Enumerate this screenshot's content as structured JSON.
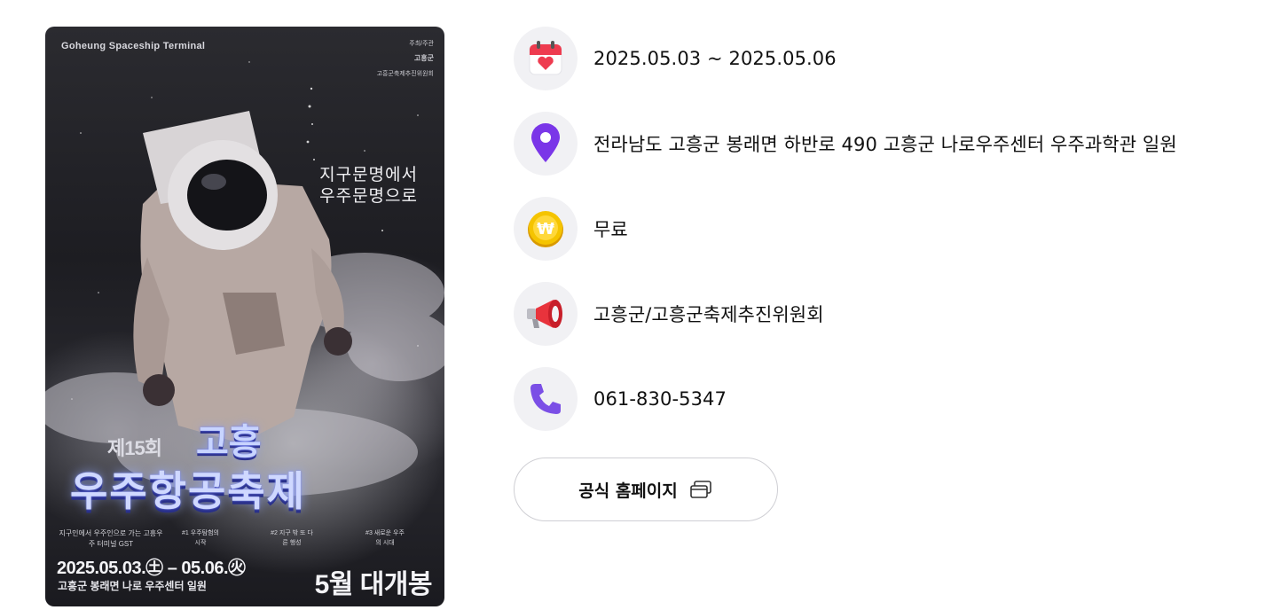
{
  "poster": {
    "brand": "Goheung Spaceship Terminal",
    "host_label": "주최/주관",
    "host_logo": "고흥군",
    "host_org": "고흥군축제추진위원회",
    "slogan_line1": "지구문명에서",
    "slogan_line2": "우주문명으로",
    "edition": "제15회",
    "title_line1": "고흥",
    "title_line2": "우주항공축제",
    "sub_intro": "지구인에서 우주인으로 가는 고흥우주 터미널 GST",
    "sub_1": "#1 우주탐험의 시작",
    "sub_2": "#2 지구 밖 또 다른 행성",
    "sub_3": "#3 새로운 우주의 시대",
    "date": "2025.05.03.㊏ – 05.06.㊋",
    "venue": "고흥군 봉래면 나로 우주센터 일원",
    "open_label": "5월 대개봉"
  },
  "info": {
    "date": {
      "icon": "calendar-icon",
      "text": "2025.05.03 ~ 2025.05.06"
    },
    "location": {
      "icon": "location-pin-icon",
      "text": "전라남도 고흥군 봉래면 하반로 490 고흥군 나로우주센터 우주과학관 일원"
    },
    "fee": {
      "icon": "won-coin-icon",
      "text": "무료"
    },
    "organizer": {
      "icon": "megaphone-icon",
      "text": "고흥군/고흥군축제추진위원회"
    },
    "phone": {
      "icon": "phone-icon",
      "text": "061-830-5347"
    }
  },
  "homepage_button": {
    "label": "공식 홈페이지",
    "icon": "new-window-icon"
  },
  "colors": {
    "icon_bg": "#f1f1f4",
    "calendar_red": "#ee3b4f",
    "pin_purple": "#7a36e8",
    "coin_yellow": "#f5c400",
    "megaphone_red": "#e8333c",
    "phone_purple": "#7b4fe6",
    "button_border": "#cfcfd4"
  }
}
